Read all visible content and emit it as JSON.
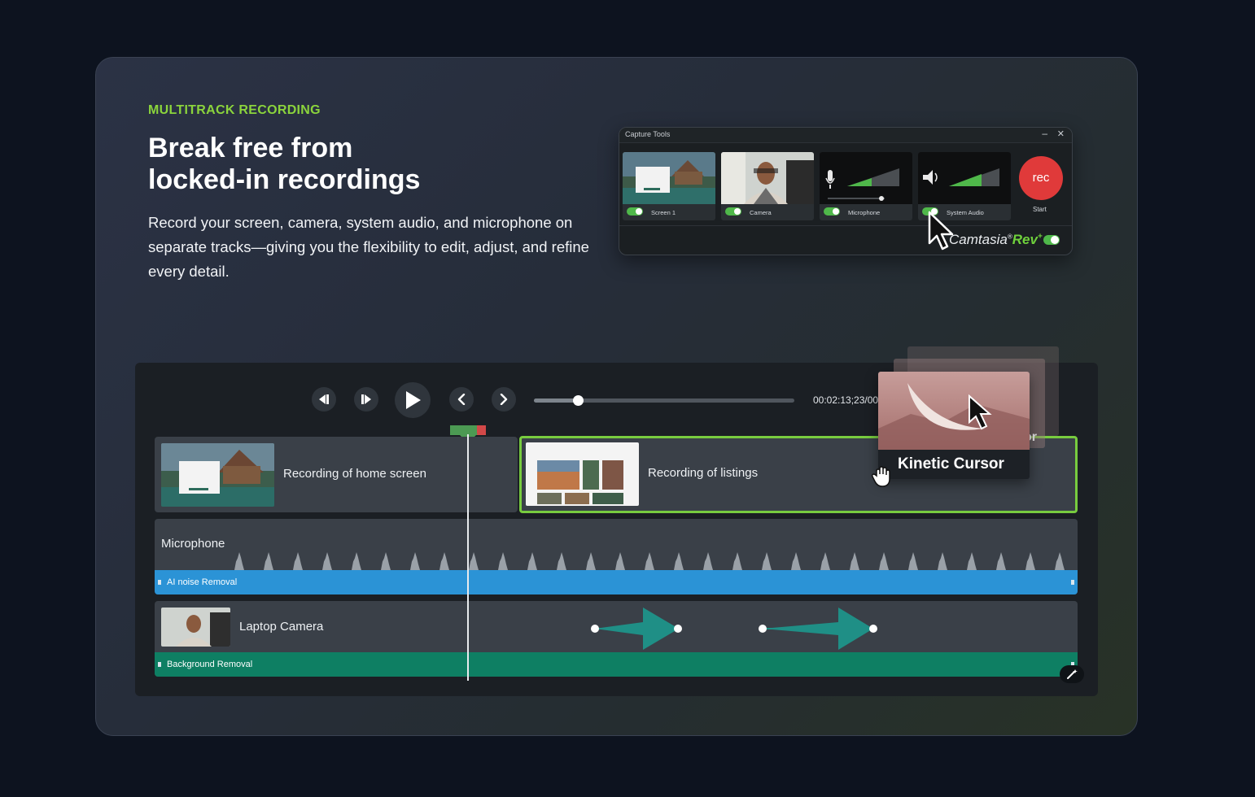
{
  "section": {
    "eyebrow": "MULTITRACK RECORDING",
    "headline_line1": "Break free from",
    "headline_line2": "locked-in recordings",
    "description": "Record your screen, camera, system audio, and microphone on separate tracks—giving you the flexibility to edit, adjust, and refine every detail."
  },
  "capture_tools": {
    "title": "Capture  Tools",
    "minimize_glyph": "–",
    "close_glyph": "✕",
    "tiles": [
      {
        "label": "Screen 1",
        "enabled": true
      },
      {
        "label": "Camera",
        "enabled": true
      },
      {
        "label": "Microphone",
        "enabled": true
      },
      {
        "label": "System Audio",
        "enabled": true
      }
    ],
    "rec_label": "rec",
    "start_label": "Start",
    "brand_main": "Camtasia",
    "brand_reg": "®",
    "brand_rev": "Rev",
    "brand_plus": "+",
    "rev_toggle_on": true,
    "colors": {
      "rec": "#e03a3a",
      "toggle": "#4fb84a",
      "rev": "#6fd13c"
    }
  },
  "editor": {
    "timecode": "00:02:13;23/00",
    "scrub_progress": 0.17,
    "clips": [
      {
        "label": "Recording of home screen"
      },
      {
        "label": "Recording of listings"
      }
    ],
    "microphone_track": {
      "name": "Microphone",
      "effect": "AI noise Removal"
    },
    "camera_track": {
      "name": "Laptop Camera",
      "effect": "Background Removal"
    },
    "kinetic_cursor_label": "Kinetic Cursor",
    "kinetic_back_text": "or",
    "colors": {
      "accent_green": "#78cc3f",
      "mic_bar": "#2b93d6",
      "cam_bar": "#0e7f63",
      "eyebrow": "#8bd43c"
    }
  }
}
